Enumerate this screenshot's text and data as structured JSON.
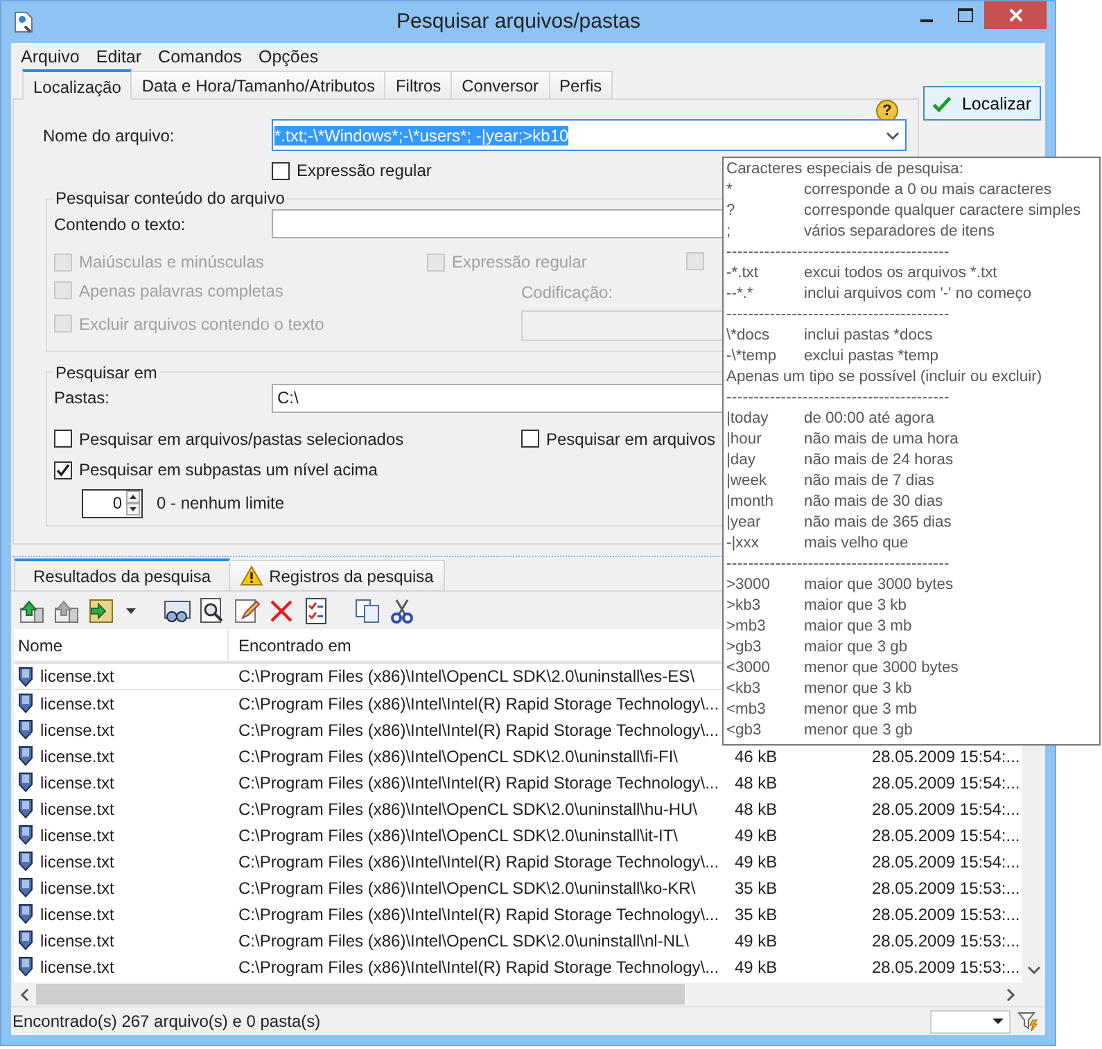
{
  "window": {
    "title": "Pesquisar arquivos/pastas"
  },
  "menu": [
    "Arquivo",
    "Editar",
    "Comandos",
    "Opções"
  ],
  "tabs": [
    {
      "label": "Localização",
      "selected": true
    },
    {
      "label": "Data e Hora/Tamanho/Atributos",
      "selected": false
    },
    {
      "label": "Filtros",
      "selected": false
    },
    {
      "label": "Conversor",
      "selected": false
    },
    {
      "label": "Perfis",
      "selected": false
    }
  ],
  "filename": {
    "label": "Nome do arquivo:",
    "value": "*.txt;-\\*Windows*;-\\*users*; -|year;>kb10",
    "text_selected": true
  },
  "regex": {
    "label": "Expressão regular",
    "checked": false
  },
  "find_button": "Localizar",
  "help_button": "?",
  "content_group": {
    "title": "Pesquisar conteúdo do arquivo",
    "text_label": "Contendo o texto:",
    "options": [
      {
        "label": "Maiúsculas e minúsculas",
        "checked": false,
        "disabled": true
      },
      {
        "label": "Expressão regular",
        "checked": false,
        "disabled": true
      },
      {
        "checked": false,
        "disabled": true
      },
      {
        "label": "Apenas palavras completas",
        "checked": false,
        "disabled": true
      },
      {
        "label": "Excluir arquivos contendo o texto",
        "checked": false,
        "disabled": true
      }
    ],
    "encoding_label": "Codificação:"
  },
  "search_in": {
    "title": "Pesquisar em",
    "folders_label": "Pastas:",
    "folders_value": "C:\\",
    "options": [
      {
        "label": "Pesquisar em arquivos/pastas selecionados",
        "checked": false
      },
      {
        "label": "Pesquisar em arquivos",
        "checked": false
      },
      {
        "label": "Pesquisar em subpastas um nível acima",
        "checked": true
      }
    ],
    "depth": {
      "value": "0",
      "label": "0 - nenhum limite"
    }
  },
  "results_tabs": [
    {
      "label": "Resultados da pesquisa",
      "selected": true,
      "kind": "plain"
    },
    {
      "label": "Registros da pesquisa",
      "selected": false,
      "kind": "warning"
    }
  ],
  "table": {
    "columns": [
      "Nome",
      "Encontrado em"
    ],
    "rows": [
      {
        "name": "license.txt",
        "path": "C:\\Program Files (x86)\\Intel\\OpenCL SDK\\2.0\\uninstall\\es-ES\\"
      },
      {
        "name": "license.txt",
        "path": "C:\\Program Files (x86)\\Intel\\Intel(R) Rapid Storage Technology\\..."
      },
      {
        "name": "license.txt",
        "path": "C:\\Program Files (x86)\\Intel\\Intel(R) Rapid Storage Technology\\..."
      },
      {
        "name": "license.txt",
        "path": "C:\\Program Files (x86)\\Intel\\OpenCL SDK\\2.0\\uninstall\\fi-FI\\",
        "size": "46 kB",
        "date": "28.05.2009 15:54:..."
      },
      {
        "name": "license.txt",
        "path": "C:\\Program Files (x86)\\Intel\\Intel(R) Rapid Storage Technology\\...",
        "size": "48 kB",
        "date": "28.05.2009 15:54:..."
      },
      {
        "name": "license.txt",
        "path": "C:\\Program Files (x86)\\Intel\\OpenCL SDK\\2.0\\uninstall\\hu-HU\\",
        "size": "48 kB",
        "date": "28.05.2009 15:54:..."
      },
      {
        "name": "license.txt",
        "path": "C:\\Program Files (x86)\\Intel\\OpenCL SDK\\2.0\\uninstall\\it-IT\\",
        "size": "49 kB",
        "date": "28.05.2009 15:54:..."
      },
      {
        "name": "license.txt",
        "path": "C:\\Program Files (x86)\\Intel\\Intel(R) Rapid Storage Technology\\...",
        "size": "49 kB",
        "date": "28.05.2009 15:54:..."
      },
      {
        "name": "license.txt",
        "path": "C:\\Program Files (x86)\\Intel\\OpenCL SDK\\2.0\\uninstall\\ko-KR\\",
        "size": "35 kB",
        "date": "28.05.2009 15:53:..."
      },
      {
        "name": "license.txt",
        "path": "C:\\Program Files (x86)\\Intel\\Intel(R) Rapid Storage Technology\\...",
        "size": "35 kB",
        "date": "28.05.2009 15:53:..."
      },
      {
        "name": "license.txt",
        "path": "C:\\Program Files (x86)\\Intel\\OpenCL SDK\\2.0\\uninstall\\nl-NL\\",
        "size": "49 kB",
        "date": "28.05.2009 15:53:..."
      },
      {
        "name": "license.txt",
        "path": "C:\\Program Files (x86)\\Intel\\Intel(R) Rapid Storage Technology\\...",
        "size": "49 kB",
        "date": "28.05.2009 15:53:..."
      }
    ]
  },
  "status_bar": "Encontrado(s) 267 arquivo(s) e 0 pasta(s)",
  "tooltip": {
    "lines": [
      {
        "kind": "title",
        "text": "Caracteres especiais de pesquisa:"
      },
      {
        "kind": "entry",
        "key": "*",
        "text": "corresponde a 0 ou mais caracteres"
      },
      {
        "kind": "entry",
        "key": "?",
        "text": "corresponde qualquer caractere simples"
      },
      {
        "kind": "entry",
        "key": ";",
        "text": "vários separadores de itens"
      },
      {
        "kind": "separator",
        "text": "-----------------------------------------"
      },
      {
        "kind": "entry",
        "key": "-*.txt",
        "text": "excui todos os arquivos *.txt"
      },
      {
        "kind": "entry",
        "key": "--*.*",
        "text": "inclui arquivos com '-' no começo"
      },
      {
        "kind": "separator",
        "text": "-----------------------------------------"
      },
      {
        "kind": "entry",
        "key": "\\*docs",
        "text": "inclui pastas *docs"
      },
      {
        "kind": "entry",
        "key": "-\\*temp",
        "text": "exclui pastas *temp"
      },
      {
        "kind": "title",
        "text": "Apenas um tipo se possível (incluir ou excluir)"
      },
      {
        "kind": "separator",
        "text": "-----------------------------------------"
      },
      {
        "kind": "entry",
        "key": "|today",
        "text": "de 00:00 até agora"
      },
      {
        "kind": "entry",
        "key": "|hour",
        "text": "não mais de uma hora"
      },
      {
        "kind": "entry",
        "key": "|day",
        "text": "não mais de 24 horas"
      },
      {
        "kind": "entry",
        "key": "|week",
        "text": "não mais de 7 dias"
      },
      {
        "kind": "entry",
        "key": "|month",
        "text": "não mais de 30 dias"
      },
      {
        "kind": "entry",
        "key": "|year",
        "text": "não mais de 365 dias"
      },
      {
        "kind": "entry",
        "key": "-|xxx",
        "text": "mais velho que"
      },
      {
        "kind": "separator",
        "text": "-----------------------------------------"
      },
      {
        "kind": "entry",
        "key": ">3000",
        "text": "maior que 3000 bytes"
      },
      {
        "kind": "entry",
        "key": ">kb3",
        "text": "maior que 3 kb"
      },
      {
        "kind": "entry",
        "key": ">mb3",
        "text": "maior que 3 mb"
      },
      {
        "kind": "entry",
        "key": ">gb3",
        "text": "maior que 3 gb"
      },
      {
        "kind": "entry",
        "key": "<3000",
        "text": "menor que 3000 bytes"
      },
      {
        "kind": "entry",
        "key": "<kb3",
        "text": "menor que 3 kb"
      },
      {
        "kind": "entry",
        "key": "<mb3",
        "text": "menor que 3 mb"
      },
      {
        "kind": "entry",
        "key": "<gb3",
        "text": "menor que 3 gb"
      }
    ]
  }
}
